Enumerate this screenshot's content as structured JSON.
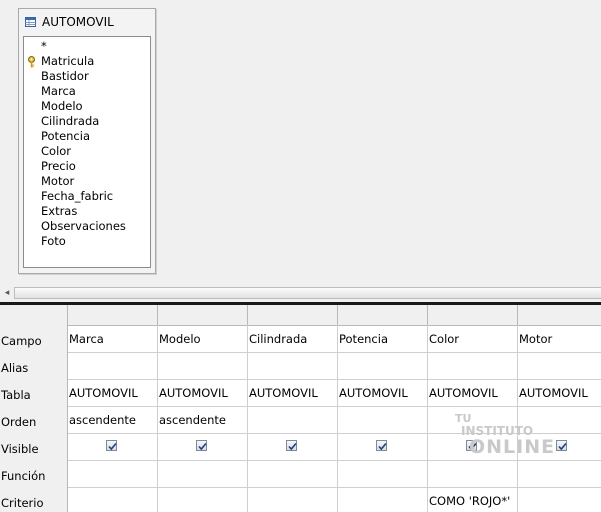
{
  "table_window": {
    "title": "AUTOMOVIL",
    "fields": [
      "*",
      "Matricula",
      "Bastidor",
      "Marca",
      "Modelo",
      "Cilindrada",
      "Potencia",
      "Color",
      "Precio",
      "Motor",
      "Fecha_fabric",
      "Extras",
      "Observaciones",
      "Foto"
    ],
    "primary_key_field": "Matricula"
  },
  "scrollbar": {
    "left_arrow": "◂"
  },
  "grid": {
    "row_labels": {
      "campo": "Campo",
      "alias": "Alias",
      "tabla": "Tabla",
      "orden": "Orden",
      "visible": "Visible",
      "funcion": "Función",
      "criterio": "Criterio"
    },
    "columns": [
      {
        "campo": "Marca",
        "alias": "",
        "tabla": "AUTOMOVIL",
        "orden": "ascendente",
        "visible": true,
        "funcion": "",
        "criterio": ""
      },
      {
        "campo": "Modelo",
        "alias": "",
        "tabla": "AUTOMOVIL",
        "orden": "ascendente",
        "visible": true,
        "funcion": "",
        "criterio": ""
      },
      {
        "campo": "Cilindrada",
        "alias": "",
        "tabla": "AUTOMOVIL",
        "orden": "",
        "visible": true,
        "funcion": "",
        "criterio": ""
      },
      {
        "campo": "Potencia",
        "alias": "",
        "tabla": "AUTOMOVIL",
        "orden": "",
        "visible": true,
        "funcion": "",
        "criterio": ""
      },
      {
        "campo": "Color",
        "alias": "",
        "tabla": "AUTOMOVIL",
        "orden": "",
        "visible": true,
        "funcion": "",
        "criterio": "COMO 'ROJO*'"
      },
      {
        "campo": "Motor",
        "alias": "",
        "tabla": "AUTOMOVIL",
        "orden": "",
        "visible": true,
        "funcion": "",
        "criterio": ""
      }
    ]
  },
  "watermark": {
    "line1": "TU",
    "line2": "INSTITUTO",
    "line3": "ONLINE"
  },
  "colors": {
    "background": "#f0f0f0",
    "grid_line": "#cfcfcf",
    "splitter": "#1a1a1a"
  }
}
